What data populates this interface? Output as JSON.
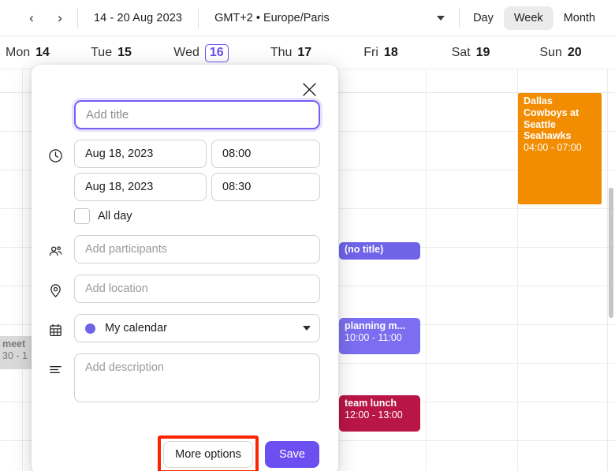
{
  "toolbar": {
    "prev_label": "‹",
    "next_label": "›",
    "date_range": "14 - 20 Aug 2023",
    "timezone": "GMT+2 • Europe/Paris",
    "views": [
      {
        "label": "Day",
        "active": false
      },
      {
        "label": "Week",
        "active": true
      },
      {
        "label": "Month",
        "active": false
      }
    ]
  },
  "day_headers": [
    {
      "name": "Mon",
      "num": "14",
      "today": false
    },
    {
      "name": "Tue",
      "num": "15",
      "today": false
    },
    {
      "name": "Wed",
      "num": "16",
      "today": true
    },
    {
      "name": "Thu",
      "num": "17",
      "today": false
    },
    {
      "name": "Fri",
      "num": "18",
      "today": false
    },
    {
      "name": "Sat",
      "num": "19",
      "today": false
    },
    {
      "name": "Sun",
      "num": "20",
      "today": false
    }
  ],
  "events": [
    {
      "title": "Dallas Cowboys at Seattle Seahawks",
      "time": "04:00 - 07:00",
      "color": "#f28c00"
    },
    {
      "title": "(no title)",
      "time": "",
      "color": "#6f63e8"
    },
    {
      "title": "planning m...",
      "time": "10:00 - 11:00",
      "color": "#7b6ef0"
    },
    {
      "title": "team lunch",
      "time": "12:00 - 13:00",
      "color": "#b91646"
    },
    {
      "title": "meet",
      "time": "30 - 1",
      "color": "#d9d9d9"
    }
  ],
  "modal": {
    "close_label": "✕",
    "title_placeholder": "Add title",
    "title_value": "",
    "start_date": "Aug 18, 2023",
    "start_time": "08:00",
    "end_date": "Aug 18, 2023",
    "end_time": "08:30",
    "all_day_label": "All day",
    "all_day_checked": false,
    "participants_placeholder": "Add participants",
    "participants_value": "",
    "location_placeholder": "Add location",
    "location_value": "",
    "calendar_name": "My calendar",
    "calendar_color": "#6f63e8",
    "description_placeholder": "Add description",
    "description_value": "",
    "more_options_label": "More options",
    "save_label": "Save",
    "highlight_color": "#fa2400"
  }
}
